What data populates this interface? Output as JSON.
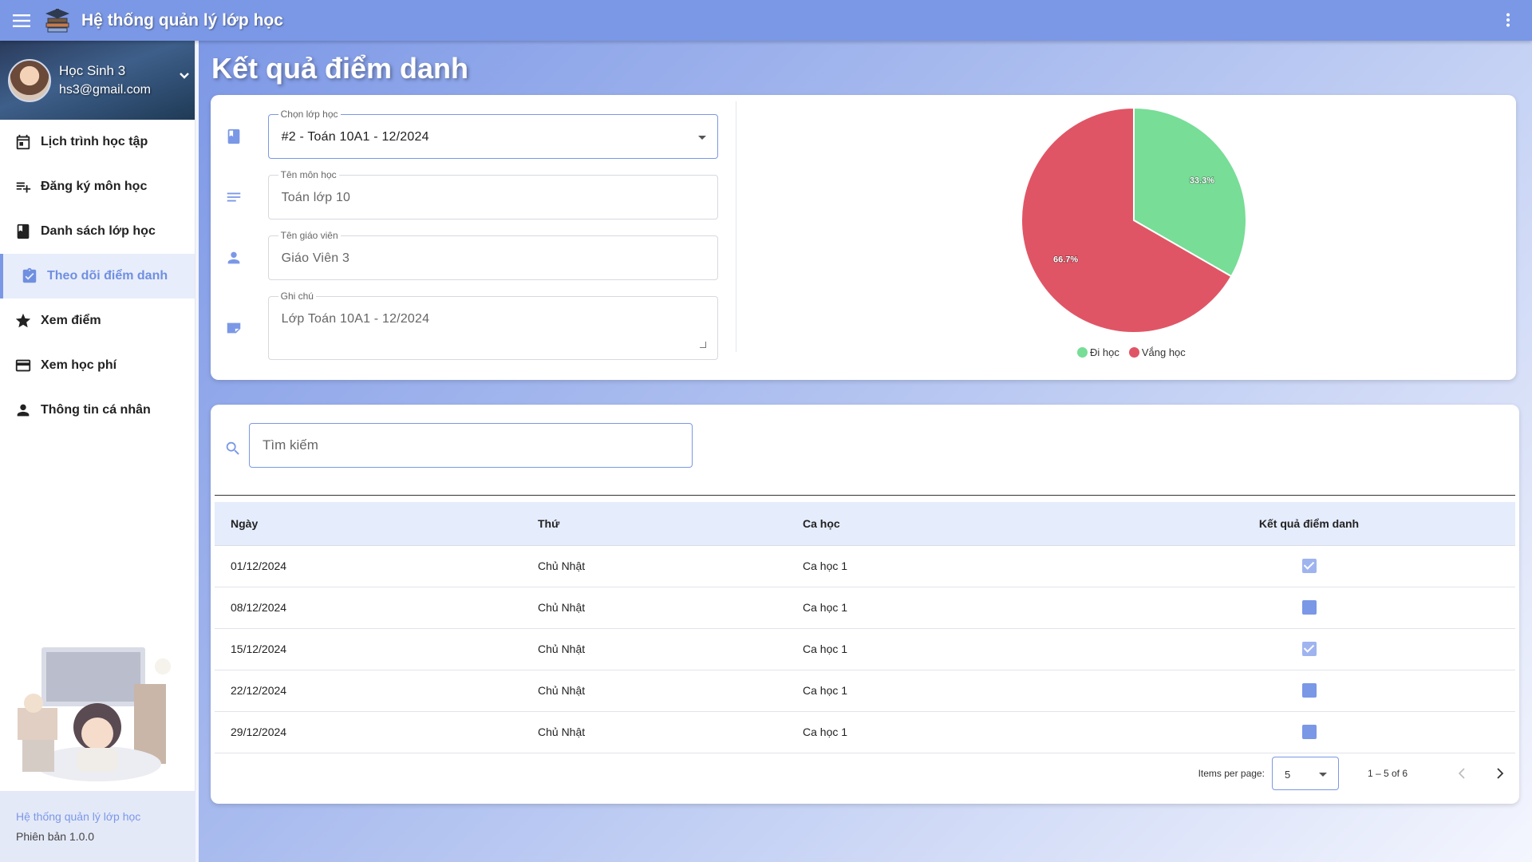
{
  "app": {
    "title": "Hệ thống quản lý lớp học"
  },
  "user": {
    "name": "Học Sinh 3",
    "email": "hs3@gmail.com"
  },
  "sidebar": {
    "items": [
      {
        "label": "Lịch trình học tập",
        "icon": "calendar-icon"
      },
      {
        "label": "Đăng ký môn học",
        "icon": "playlist-add-icon"
      },
      {
        "label": "Danh sách lớp học",
        "icon": "book-icon"
      },
      {
        "label": "Theo dõi điểm danh",
        "icon": "assignment-check-icon",
        "active": true
      },
      {
        "label": "Xem điểm",
        "icon": "star-icon"
      },
      {
        "label": "Xem học phí",
        "icon": "credit-card-icon"
      },
      {
        "label": "Thông tin cá nhân",
        "icon": "person-icon"
      }
    ],
    "footer": {
      "name": "Hệ thống quản lý lớp học",
      "version_label": "Phiên bản",
      "version": "1.0.0"
    }
  },
  "page": {
    "title": "Kết quả điểm danh"
  },
  "form": {
    "class_select": {
      "label": "Chọn lớp học",
      "value": "#2 - Toán 10A1 - 12/2024"
    },
    "subject": {
      "label": "Tên môn học",
      "value": "Toán lớp 10"
    },
    "teacher": {
      "label": "Tên giáo viên",
      "value": "Giáo Viên 3"
    },
    "note": {
      "label": "Ghi chú",
      "value": "Lớp Toán 10A1 - 12/2024"
    }
  },
  "chart_data": {
    "type": "pie",
    "labels": [
      "Đi học",
      "Vắng học"
    ],
    "values": [
      33.3,
      66.7
    ],
    "data_labels": [
      "33.3%",
      "66.7%"
    ],
    "colors": [
      "#77dd97",
      "#e05565"
    ],
    "legend_position": "bottom"
  },
  "search": {
    "placeholder": "Tìm kiếm"
  },
  "table": {
    "headers": [
      "Ngày",
      "Thứ",
      "Ca học",
      "Kết quả điểm danh"
    ],
    "rows": [
      {
        "date": "01/12/2024",
        "weekday": "Chủ Nhật",
        "shift": "Ca học 1",
        "present": true
      },
      {
        "date": "08/12/2024",
        "weekday": "Chủ Nhật",
        "shift": "Ca học 1",
        "present": false
      },
      {
        "date": "15/12/2024",
        "weekday": "Chủ Nhật",
        "shift": "Ca học 1",
        "present": true
      },
      {
        "date": "22/12/2024",
        "weekday": "Chủ Nhật",
        "shift": "Ca học 1",
        "present": false
      },
      {
        "date": "29/12/2024",
        "weekday": "Chủ Nhật",
        "shift": "Ca học 1",
        "present": false
      }
    ]
  },
  "paginator": {
    "items_per_page_label": "Items per page:",
    "page_size": "5",
    "range": "1 – 5 of 6"
  },
  "colors": {
    "accent": "#7b98e6",
    "present": "#77dd97",
    "absent": "#e05565"
  }
}
